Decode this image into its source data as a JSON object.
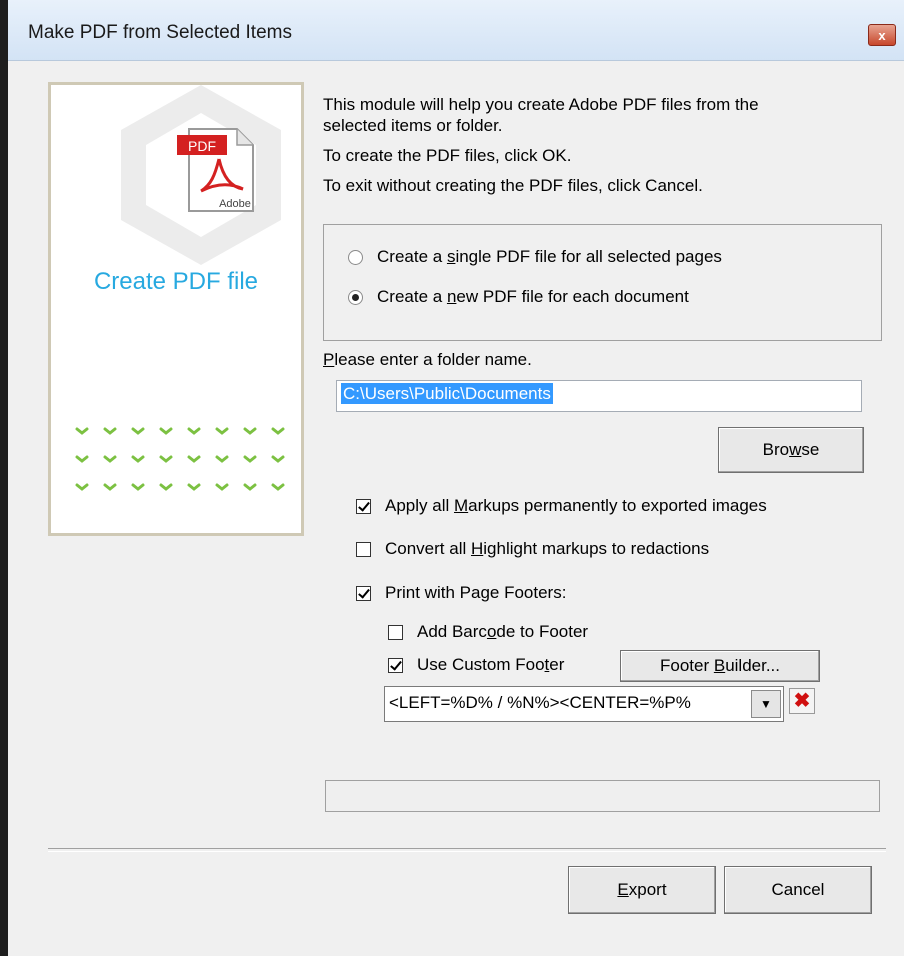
{
  "window": {
    "title": "Make PDF from Selected Items",
    "close_glyph": "x"
  },
  "side": {
    "pdf_icon_label": "PDF",
    "pdf_icon_brand": "Adobe",
    "title": "Create PDF file"
  },
  "intro": {
    "line1": "This module will help you create Adobe PDF files from the",
    "line2": "selected items or folder.",
    "line3": "To create the PDF files, click OK.",
    "line4": "To exit without creating the PDF files, click Cancel."
  },
  "output_mode": {
    "single": {
      "pre": "Create a ",
      "key": "s",
      "post": "ingle PDF file for all selected pages",
      "selected": false
    },
    "each": {
      "pre": "Create a ",
      "key": "n",
      "post": "ew PDF file for each document",
      "selected": true
    }
  },
  "folder": {
    "label_key": "P",
    "label_rest": "lease enter a folder name.",
    "value": "C:\\Users\\Public\\Documents"
  },
  "browse": {
    "pre": "Bro",
    "key": "w",
    "post": "se"
  },
  "options": {
    "apply_markups": {
      "pre": "Apply all ",
      "key": "M",
      "post": "arkups permanently to exported images",
      "checked": true
    },
    "convert_highlight": {
      "pre": "Convert all ",
      "key": "H",
      "post": "ighlight markups to redactions",
      "checked": false
    },
    "print_footers": {
      "pre": "Print with Pa",
      "key": "g",
      "post": "e Footers:",
      "checked": true
    },
    "add_barcode": {
      "pre": "Add Barc",
      "key": "o",
      "post": "de to Footer",
      "checked": false
    },
    "custom_footer": {
      "pre": "Use Custom Foo",
      "key": "t",
      "post": "er",
      "checked": true
    }
  },
  "footer_builder": {
    "pre": "Footer ",
    "key": "B",
    "post": "uilder..."
  },
  "footer_combo": {
    "value": "<LEFT=%D% / %N%><CENTER=%P%",
    "arrow": "▼",
    "delete_glyph": "✖"
  },
  "buttons": {
    "export": {
      "key": "E",
      "post": "xport"
    },
    "cancel": "Cancel"
  }
}
